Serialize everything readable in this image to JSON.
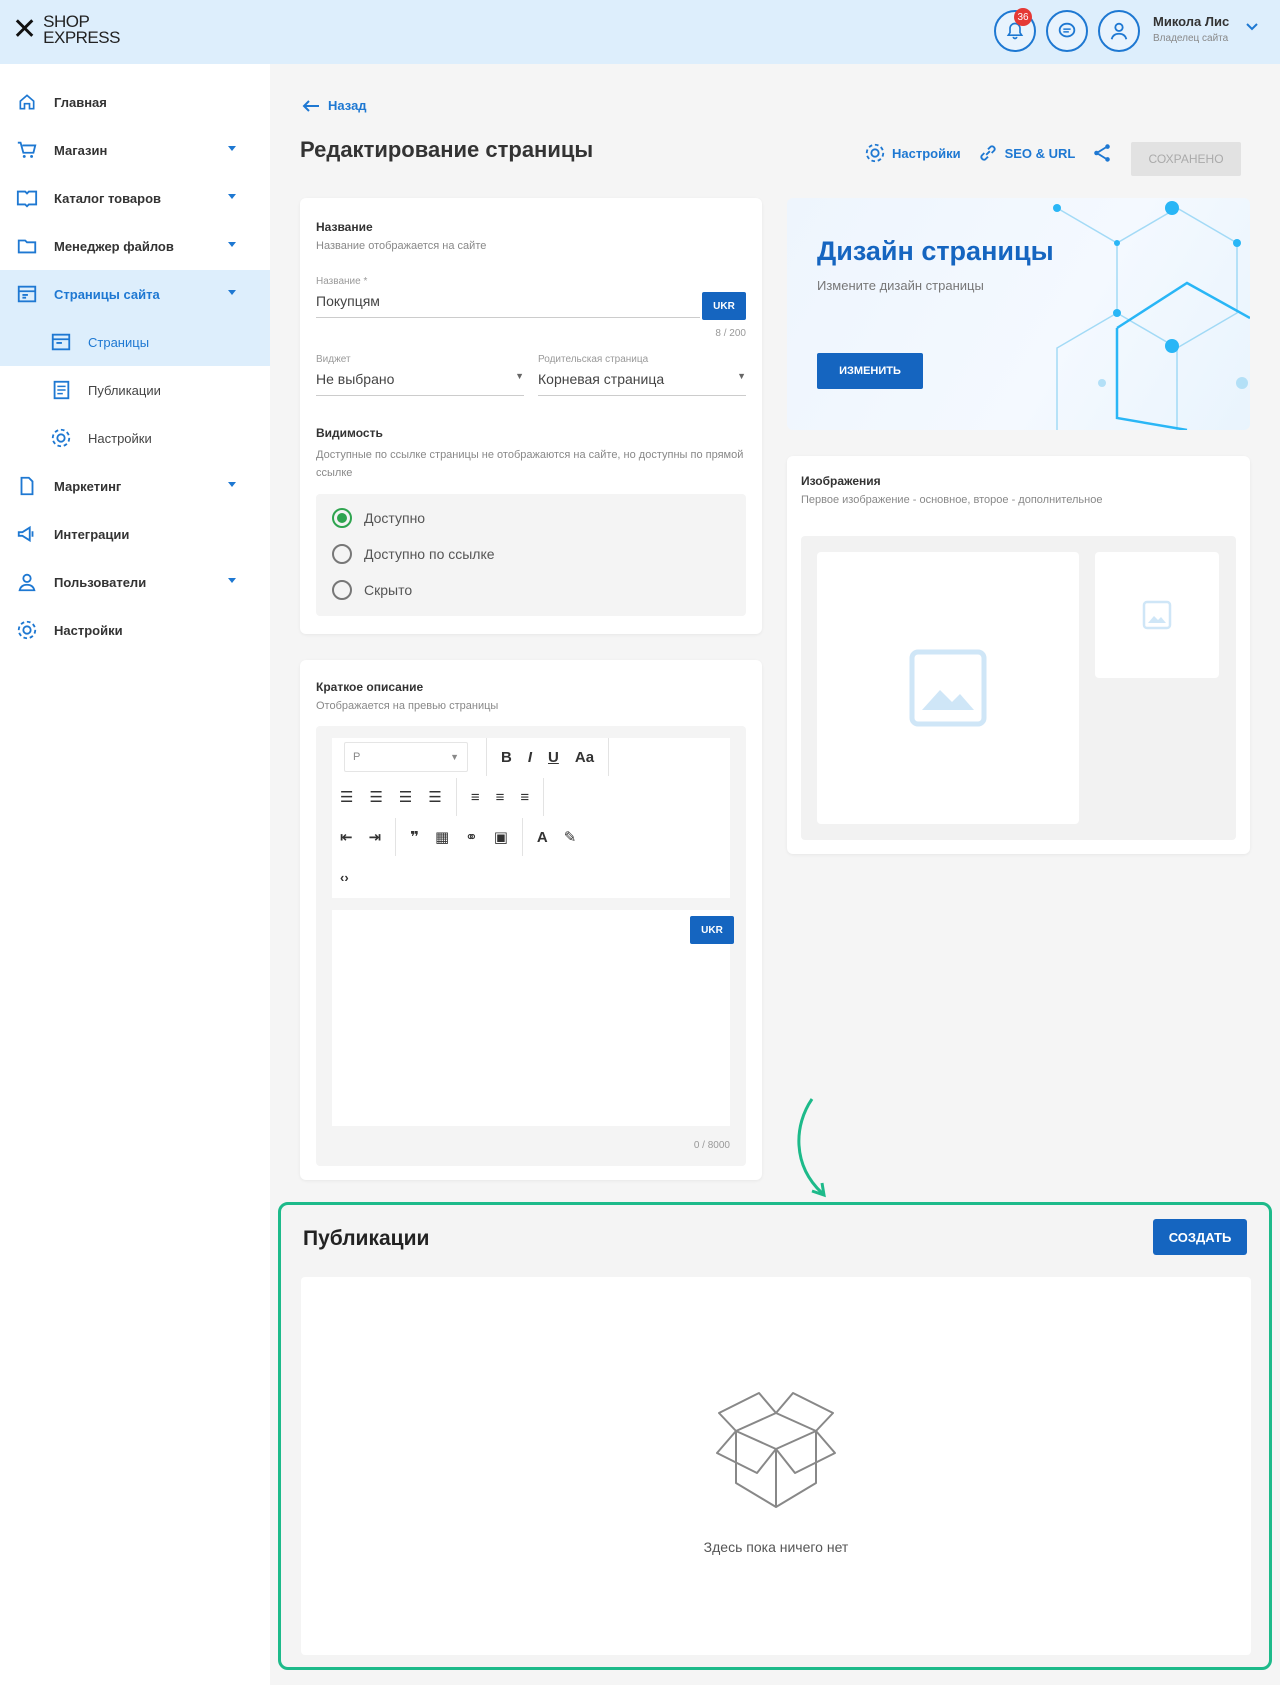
{
  "brand": {
    "logo_top": "SHOP",
    "logo_bottom": "EXPRESS"
  },
  "header": {
    "notif_count": "36",
    "user_name": "Микола Лис",
    "user_role": "Владелец сайта"
  },
  "sidebar": {
    "items": [
      {
        "label": "Главная",
        "icon": "home-icon"
      },
      {
        "label": "Магазин",
        "icon": "cart-icon"
      },
      {
        "label": "Каталог товаров",
        "icon": "book-icon"
      },
      {
        "label": "Менеджер файлов",
        "icon": "folder-icon"
      },
      {
        "label": "Страницы сайта",
        "icon": "pages-icon"
      },
      {
        "label": "Страницы",
        "icon": "page-icon"
      },
      {
        "label": "Публикации",
        "icon": "publications-icon"
      },
      {
        "label": "Настройки",
        "icon": "gear-icon"
      },
      {
        "label": "Маркетинг",
        "icon": "marketing-icon"
      },
      {
        "label": "Интеграции",
        "icon": "megaphone-icon"
      },
      {
        "label": "Пользователи",
        "icon": "users-icon"
      },
      {
        "label": "Настройки",
        "icon": "gear-icon"
      }
    ]
  },
  "main": {
    "back_label": "Назад",
    "title": "Редактирование страницы",
    "toolbar": {
      "settings": "Настройки",
      "seo": "SEO & URL",
      "saved": "СОХРАНЕНО"
    }
  },
  "name_card": {
    "title": "Название",
    "subtitle": "Название отображается на сайте",
    "field_label": "Название *",
    "field_value": "Покупцям",
    "lang": "UKR",
    "counter": "8 / 200",
    "widget_label": "Виджет",
    "widget_value": "Не выбрано",
    "parent_label": "Родительская страница",
    "parent_value": "Корневая страница",
    "visibility_title": "Видимость",
    "visibility_sub": "Доступные по ссылке страницы не отображаются на сайте, но доступны по прямой ссылке",
    "options": [
      "Доступно",
      "Доступно по ссылке",
      "Скрыто"
    ]
  },
  "desc_card": {
    "title": "Краткое описание",
    "subtitle": "Отображается на превью страницы",
    "format": "P",
    "lang": "UKR",
    "counter": "0 / 8000"
  },
  "design_card": {
    "title": "Дизайн страницы",
    "subtitle": "Измените дизайн страницы",
    "button": "ИЗМЕНИТЬ"
  },
  "images_card": {
    "title": "Изображения",
    "subtitle": "Первое изображение - основное, второе - дополнительное"
  },
  "publications": {
    "title": "Публикации",
    "create": "СОЗДАТЬ",
    "empty": "Здесь пока ничего нет"
  },
  "colors": {
    "accent": "#1565c0",
    "highlight": "#1dba8a",
    "header_bg": "#ddeefc"
  }
}
